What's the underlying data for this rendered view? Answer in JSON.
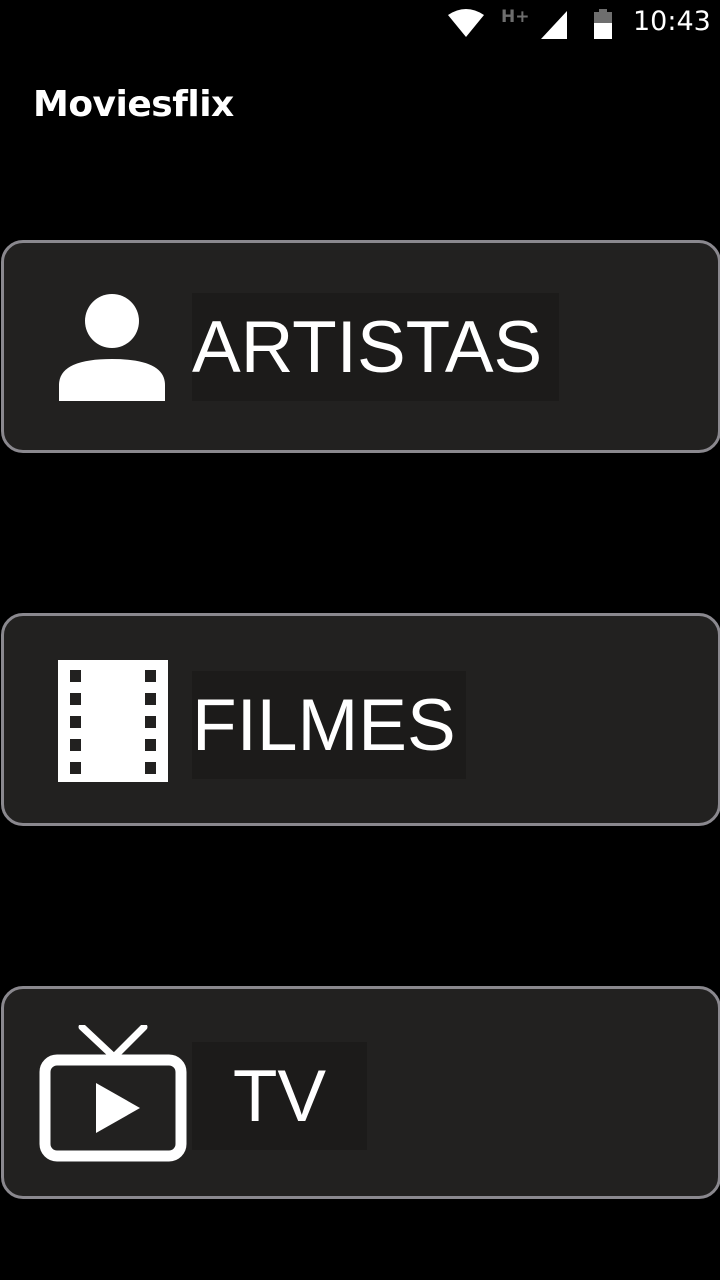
{
  "status_bar": {
    "network_type": "H+",
    "time": "10:43",
    "icons": [
      "wifi-icon",
      "signal-icon",
      "battery-icon"
    ]
  },
  "app": {
    "title": "Moviesflix"
  },
  "menu": {
    "items": [
      {
        "label": "ARTISTAS",
        "icon": "person-icon"
      },
      {
        "label": "FILMES",
        "icon": "film-strip-icon"
      },
      {
        "label": "TV",
        "icon": "tv-play-icon"
      }
    ]
  },
  "colors": {
    "background": "#000000",
    "card_background": "#222120",
    "card_border": "#8a888e",
    "text": "#ffffff"
  }
}
